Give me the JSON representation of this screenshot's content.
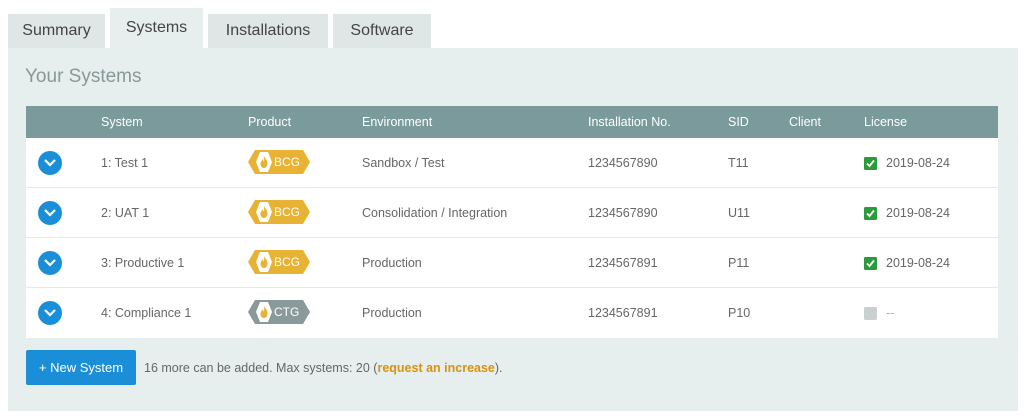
{
  "tabs": [
    {
      "label": "Summary"
    },
    {
      "label": "Systems"
    },
    {
      "label": "Installations"
    },
    {
      "label": "Software"
    }
  ],
  "panel_title": "Your Systems",
  "columns": {
    "system": "System",
    "product": "Product",
    "environment": "Environment",
    "installation": "Installation No.",
    "sid": "SID",
    "client": "Client",
    "license": "License"
  },
  "rows": [
    {
      "system": "1: Test 1",
      "product": "BCG",
      "environment": "Sandbox / Test",
      "installation": "1234567890",
      "sid": "T11",
      "client": "",
      "license": "2019-08-24"
    },
    {
      "system": "2: UAT 1",
      "product": "BCG",
      "environment": "Consolidation / Integration",
      "installation": "1234567890",
      "sid": "U11",
      "client": "",
      "license": "2019-08-24"
    },
    {
      "system": "3: Productive 1",
      "product": "BCG",
      "environment": "Production",
      "installation": "1234567891",
      "sid": "P11",
      "client": "",
      "license": "2019-08-24"
    },
    {
      "system": "4: Compliance 1",
      "product": "CTG",
      "environment": "Production",
      "installation": "1234567891",
      "sid": "P10",
      "client": "",
      "license": "--"
    }
  ],
  "footer": {
    "new_button": "+ New System",
    "text_before": "16 more can be added. Max systems: 20 (",
    "link": "request an increase",
    "text_after": ")."
  },
  "colors": {
    "accent": "#1a8fd8",
    "header": "#7a9a9b",
    "bcg_badge": "#e8b234",
    "ctg_badge": "#8a9a9b",
    "license_ok": "#2a9a3a",
    "link": "#d8920f"
  }
}
